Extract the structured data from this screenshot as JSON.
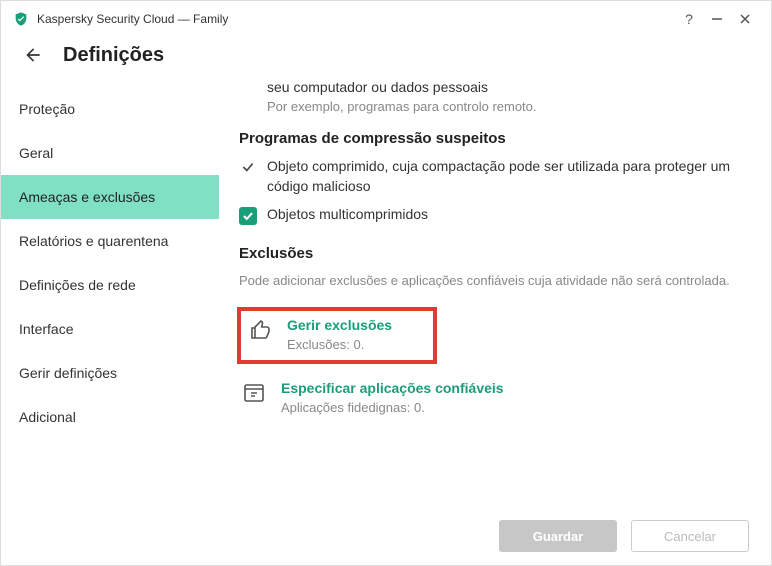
{
  "window": {
    "title": "Kaspersky Security Cloud — Family"
  },
  "page": {
    "title": "Definições"
  },
  "sidebar": {
    "items": [
      {
        "label": "Proteção"
      },
      {
        "label": "Geral"
      },
      {
        "label": "Ameaças e exclusões"
      },
      {
        "label": "Relatórios e quarentena"
      },
      {
        "label": "Definições de rede"
      },
      {
        "label": "Interface"
      },
      {
        "label": "Gerir definições"
      },
      {
        "label": "Adicional"
      }
    ],
    "activeIndex": 2
  },
  "content": {
    "top_line": "seu computador ou dados pessoais",
    "example": "Por exemplo, programas para controlo remoto.",
    "compress_heading": "Programas de compressão suspeitos",
    "compress_item1": "Objeto comprimido, cuja compactação pode ser utilizada para proteger um código malicioso",
    "compress_item2": "Objetos multicomprimidos",
    "exclusions_heading": "Exclusões",
    "exclusions_desc": "Pode adicionar exclusões e aplicações confiáveis cuja atividade não será controlada.",
    "manage_exclusions": {
      "label": "Gerir exclusões",
      "sub": "Exclusões: 0."
    },
    "trusted_apps": {
      "label": "Especificar aplicações confiáveis",
      "sub": "Aplicações fidedignas: 0."
    }
  },
  "footer": {
    "save": "Guardar",
    "cancel": "Cancelar"
  }
}
